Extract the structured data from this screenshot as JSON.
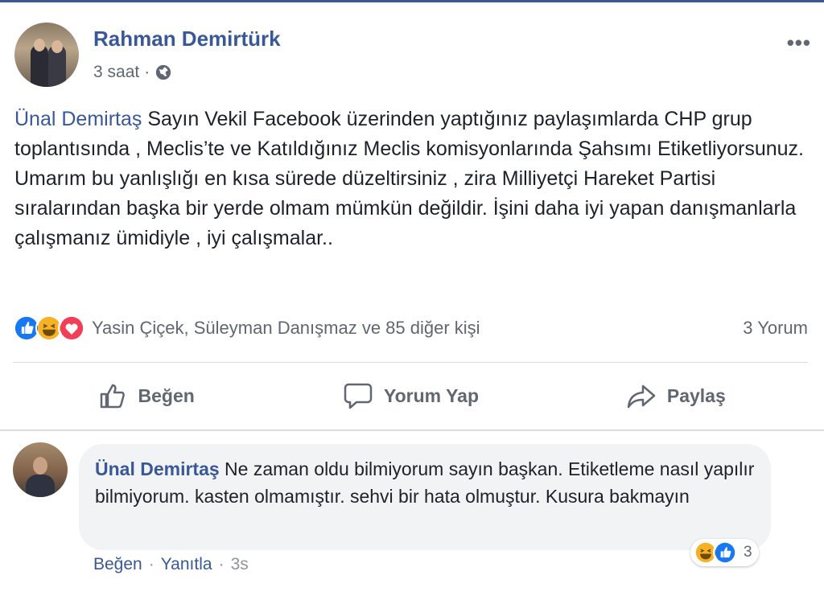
{
  "post": {
    "author": "Rahman Demirtürk",
    "time": "3 saat",
    "time_separator": "·",
    "more": "•••",
    "mention": "Ünal Demirtaş",
    "text": " Sayın Vekil Facebook üzerinden yaptığınız paylaşımlarda CHP grup toplantısında , Meclis’te ve Katıldığınız Meclis komisyonlarında Şahsımı Etiketliyorsunuz. Umarım bu yanlışlığı en kısa sürede düzeltirsiniz , zira Milliyetçi Hareket Partisi sıralarından başka bir yerde olmam mümkün değildir. İşini daha iyi yapan danışmanlarla çalışmanız ümidiyle , iyi çalışmalar..",
    "reactions": [
      "like-icon",
      "haha-icon",
      "love-icon"
    ],
    "reactors": "Yasin Çiçek, Süleyman Danışmaz ve 85 diğer kişi",
    "comment_count": "3 Yorum"
  },
  "actions": {
    "like": "Beğen",
    "comment": "Yorum Yap",
    "share": "Paylaş"
  },
  "comment": {
    "author": "Ünal Demirtaş",
    "text": " Ne zaman oldu bilmiyorum sayın başkan. Etiketleme nasıl yapılır bilmiyorum. kasten olmamıştır. sehvi bir hata olmuştur. Kusura bakmayın",
    "reactions": [
      "haha-icon",
      "like-icon"
    ],
    "reaction_count": "3",
    "like": "Beğen",
    "sep1": "·",
    "reply": "Yanıtla",
    "sep2": "·",
    "time": "3s"
  },
  "colors": {
    "link": "#385898",
    "secondary": "#606770",
    "like": "#1877f2",
    "love": "#f33e58",
    "haha": "#f7b125"
  }
}
